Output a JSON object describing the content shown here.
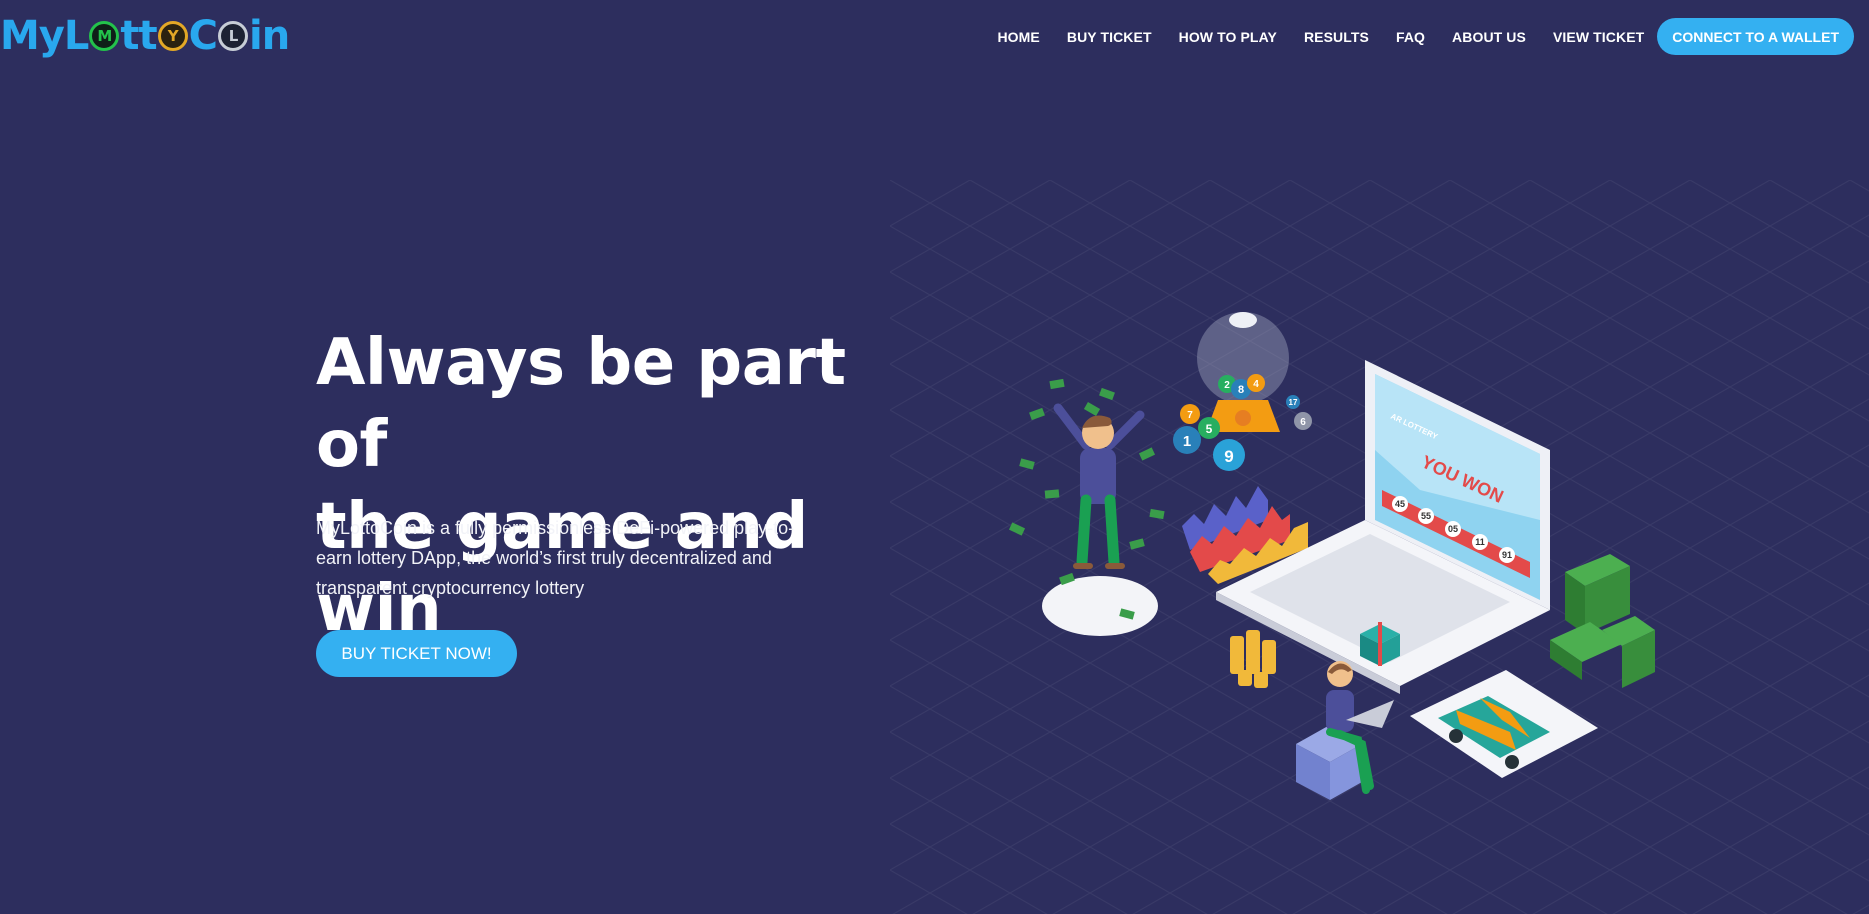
{
  "header": {
    "logo": {
      "part1": "MyL",
      "coin1": "M",
      "coin2": "Y",
      "coin3": "L",
      "part2": "C",
      "part3": "in",
      "tt": "tt"
    },
    "nav": [
      {
        "label": "HOME"
      },
      {
        "label": "BUY TICKET"
      },
      {
        "label": "HOW TO PLAY"
      },
      {
        "label": "RESULTS"
      },
      {
        "label": "FAQ"
      },
      {
        "label": "ABOUT US"
      },
      {
        "label": "VIEW TICKET"
      }
    ],
    "wallet_button": "CONNECT TO A WALLET"
  },
  "hero": {
    "title_line1": "Always be part of",
    "title_line2": "the game and win",
    "description": "MyLottoCoin is a fully permissionless DeFi-powered play-to-earn lottery DApp, the world’s first truly decentralized and transparent cryptocurrency lottery",
    "cta": "BUY TICKET NOW!"
  },
  "illustration": {
    "screen_header": "AR LOTTERY",
    "screen_text": "YOU WON",
    "numbers": [
      "45",
      "55",
      "05",
      "11",
      "91"
    ],
    "balls": [
      "7",
      "2",
      "8",
      "4",
      "5",
      "1",
      "9",
      "17",
      "6"
    ]
  },
  "colors": {
    "background": "#2d2e5e",
    "accent": "#34b0f1",
    "logo_blue": "#29a8ee"
  }
}
